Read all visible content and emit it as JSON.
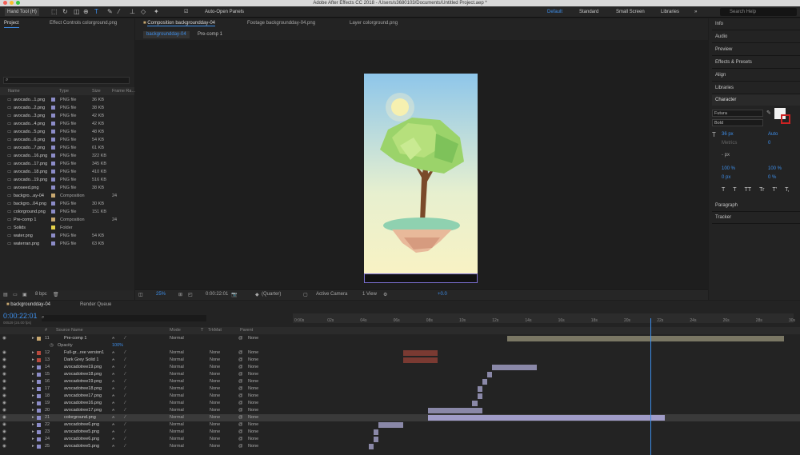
{
  "window": {
    "title": "Adobe After Effects CC 2018 - /Users/s3680103/Documents/Untitled Project.aep *"
  },
  "toolbar": {
    "hand_tool": "Hand Tool (H)",
    "auto_open": "Auto-Open Panels",
    "workspaces": [
      "Default",
      "Standard",
      "Small Screen",
      "Libraries"
    ],
    "search_placeholder": "Search Help"
  },
  "project": {
    "tab": "Project",
    "tab2": "Effect Controls colorground.png",
    "columns": [
      "Name",
      "Type",
      "Size",
      "Frame Ra..."
    ],
    "items": [
      {
        "name": "avocado...1.png",
        "type": "PNG file",
        "size": "36 KB",
        "color": "#8c8cc8"
      },
      {
        "name": "avocado...2.png",
        "type": "PNG file",
        "size": "38 KB",
        "color": "#8c8cc8"
      },
      {
        "name": "avocado...3.png",
        "type": "PNG file",
        "size": "42 KB",
        "color": "#8c8cc8"
      },
      {
        "name": "avocado...4.png",
        "type": "PNG file",
        "size": "42 KB",
        "color": "#8c8cc8"
      },
      {
        "name": "avocado...5.png",
        "type": "PNG file",
        "size": "48 KB",
        "color": "#8c8cc8"
      },
      {
        "name": "avocado...6.png",
        "type": "PNG file",
        "size": "54 KB",
        "color": "#8c8cc8"
      },
      {
        "name": "avocado...7.png",
        "type": "PNG file",
        "size": "61 KB",
        "color": "#8c8cc8"
      },
      {
        "name": "avocado...16.png",
        "type": "PNG file",
        "size": "322 KB",
        "color": "#8c8cc8"
      },
      {
        "name": "avocado...17.png",
        "type": "PNG file",
        "size": "345 KB",
        "color": "#8c8cc8"
      },
      {
        "name": "avocado...18.png",
        "type": "PNG file",
        "size": "410 KB",
        "color": "#8c8cc8"
      },
      {
        "name": "avocado...19.png",
        "type": "PNG file",
        "size": "516 KB",
        "color": "#8c8cc8"
      },
      {
        "name": "avoseed.png",
        "type": "PNG file",
        "size": "38 KB",
        "color": "#8c8cc8"
      },
      {
        "name": "backgro...ay-04",
        "type": "Composition",
        "size": "",
        "fr": "24",
        "color": "#c8a870"
      },
      {
        "name": "backgro...04.png",
        "type": "PNG file",
        "size": "30 KB",
        "color": "#8c8cc8"
      },
      {
        "name": "colorground.png",
        "type": "PNG file",
        "size": "151 KB",
        "color": "#8c8cc8"
      },
      {
        "name": "Pre-comp 1",
        "type": "Composition",
        "size": "",
        "fr": "24",
        "color": "#c8a870"
      },
      {
        "name": "Solids",
        "type": "Folder",
        "size": "",
        "color": "#e6d24a"
      },
      {
        "name": "water.png",
        "type": "PNG file",
        "size": "54 KB",
        "color": "#8c8cc8"
      },
      {
        "name": "waterran.png",
        "type": "PNG file",
        "size": "63 KB",
        "color": "#8c8cc8"
      }
    ],
    "bpc": "8 bpc"
  },
  "comp": {
    "tab": "Composition backgroundday-04",
    "footage_tab": "Footage backgroundday-04.png",
    "layer_tab": "Layer colorground.png",
    "subtabs": [
      "backgroundday-04",
      "Pre-comp 1"
    ],
    "zoom": "25%",
    "time": "0:00:22:01",
    "res": "(Quarter)",
    "camera": "Active Camera",
    "view": "1 View",
    "exposure": "+0.0"
  },
  "right": {
    "items": [
      "Info",
      "Audio",
      "Preview",
      "Effects & Presets",
      "Align",
      "Libraries"
    ],
    "character": "Character",
    "font": "Futura",
    "style": "Bold",
    "size": "36 px",
    "leading": "Auto",
    "kerning": "Metrics",
    "tracking": "0",
    "stroke": "- px",
    "vscale": "100 %",
    "hscale": "100 %",
    "baseline": "0 px",
    "tsume": "0 %",
    "bottom": [
      "Paragraph",
      "Tracker"
    ],
    "styles": [
      "T",
      "T",
      "TT",
      "Tr",
      "T'",
      "T,"
    ]
  },
  "timeline": {
    "tab": "backgroundday-04",
    "tab2": "Render Queue",
    "timecode": "0:00:22:01",
    "frames": "00529 (24.00 fps)",
    "cols": [
      "#",
      "Source Name",
      "Mode",
      "T",
      "TrkMat",
      "Parent"
    ],
    "ruler": [
      "0:00s",
      "02s",
      "04s",
      "06s",
      "08s",
      "10s",
      "12s",
      "14s",
      "16s",
      "18s",
      "20s",
      "22s",
      "24s",
      "26s",
      "28s",
      "30s"
    ],
    "layers": [
      {
        "n": "11",
        "name": "Pre-comp 1",
        "mode": "Normal",
        "trk": "",
        "parent": "None",
        "color": "#c8a870",
        "bar": [
          0.43,
          0.99
        ],
        "barcolor": "#7a7764"
      },
      {
        "n": "",
        "name": "Opacity",
        "value": "100%",
        "prop": true
      },
      {
        "n": "12",
        "name": "Full-gr...ree version1",
        "mode": "Normal",
        "trk": "None",
        "parent": "None",
        "color": "#b84a3e",
        "bar": [
          0.22,
          0.29
        ],
        "barcolor": "#7a3a32"
      },
      {
        "n": "13",
        "name": "Dark Grey Solid 1",
        "mode": "Normal",
        "trk": "None",
        "parent": "None",
        "color": "#b84a3e",
        "bar": [
          0.22,
          0.29
        ],
        "barcolor": "#7a3a32"
      },
      {
        "n": "14",
        "name": "avocadotree19.png",
        "mode": "Normal",
        "trk": "None",
        "parent": "None",
        "color": "#8c8cc8",
        "bar": [
          0.4,
          0.49
        ],
        "barcolor": "#8a88a8"
      },
      {
        "n": "15",
        "name": "avocadotree18.png",
        "mode": "Normal",
        "trk": "None",
        "parent": "None",
        "color": "#8c8cc8",
        "bar": [
          0.39,
          0.4
        ],
        "barcolor": "#8a88a8"
      },
      {
        "n": "16",
        "name": "avocadotree19.png",
        "mode": "Normal",
        "trk": "None",
        "parent": "None",
        "color": "#8c8cc8",
        "bar": [
          0.38,
          0.39
        ],
        "barcolor": "#8a88a8"
      },
      {
        "n": "17",
        "name": "avocadotree18.png",
        "mode": "Normal",
        "trk": "None",
        "parent": "None",
        "color": "#8c8cc8",
        "bar": [
          0.37,
          0.38
        ],
        "barcolor": "#8a88a8"
      },
      {
        "n": "18",
        "name": "avocadotree17.png",
        "mode": "Normal",
        "trk": "None",
        "parent": "None",
        "color": "#8c8cc8",
        "bar": [
          0.37,
          0.38
        ],
        "barcolor": "#8a88a8"
      },
      {
        "n": "19",
        "name": "avocadotree16.png",
        "mode": "Normal",
        "trk": "None",
        "parent": "None",
        "color": "#8c8cc8",
        "bar": [
          0.36,
          0.37
        ],
        "barcolor": "#8a88a8"
      },
      {
        "n": "20",
        "name": "avocadotree17.png",
        "mode": "Normal",
        "trk": "None",
        "parent": "None",
        "color": "#8c8cc8",
        "bar": [
          0.27,
          0.38
        ],
        "barcolor": "#8a88a8"
      },
      {
        "n": "21",
        "name": "colorground.png",
        "mode": "Normal",
        "trk": "None",
        "parent": "None",
        "color": "#8c8cc8",
        "bar": [
          0.27,
          0.75
        ],
        "barcolor": "#a09cc8",
        "sel": true
      },
      {
        "n": "22",
        "name": "avocadotree6.png",
        "mode": "Normal",
        "trk": "None",
        "parent": "None",
        "color": "#8c8cc8",
        "bar": [
          0.17,
          0.22
        ],
        "barcolor": "#8a88a8"
      },
      {
        "n": "23",
        "name": "avocadotree5.png",
        "mode": "Normal",
        "trk": "None",
        "parent": "None",
        "color": "#8c8cc8",
        "bar": [
          0.16,
          0.17
        ],
        "barcolor": "#8a88a8"
      },
      {
        "n": "24",
        "name": "avocadotree6.png",
        "mode": "Normal",
        "trk": "None",
        "parent": "None",
        "color": "#8c8cc8",
        "bar": [
          0.16,
          0.17
        ],
        "barcolor": "#8a88a8"
      },
      {
        "n": "25",
        "name": "avocadotree5.png",
        "mode": "Normal",
        "trk": "None",
        "parent": "None",
        "color": "#8c8cc8",
        "bar": [
          0.15,
          0.16
        ],
        "barcolor": "#8a88a8"
      }
    ],
    "playhead": 0.72
  }
}
